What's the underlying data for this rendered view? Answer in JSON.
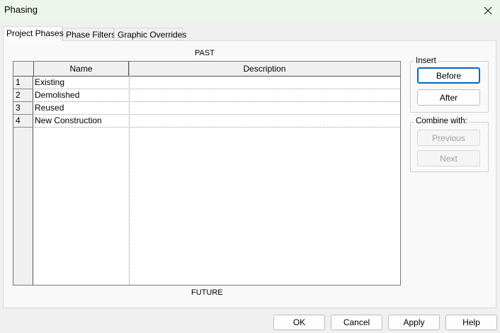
{
  "window": {
    "title": "Phasing"
  },
  "tabs": [
    {
      "label": "Project Phases",
      "active": true
    },
    {
      "label": "Phase Filters",
      "active": false
    },
    {
      "label": "Graphic Overrides",
      "active": false
    }
  ],
  "phases": {
    "past_caption": "PAST",
    "future_caption": "FUTURE",
    "columns": [
      "Name",
      "Description"
    ],
    "rows": [
      {
        "num": "1",
        "name": "Existing",
        "description": ""
      },
      {
        "num": "2",
        "name": "Demolished",
        "description": ""
      },
      {
        "num": "3",
        "name": "Reused",
        "description": ""
      },
      {
        "num": "4",
        "name": "New Construction",
        "description": ""
      }
    ]
  },
  "insert": {
    "legend": "Insert",
    "before_label": "Before",
    "after_label": "After"
  },
  "combine": {
    "legend": "Combine with:",
    "previous_label": "Previous",
    "next_label": "Next"
  },
  "footer": {
    "ok_label": "OK",
    "cancel_label": "Cancel",
    "apply_label": "Apply",
    "help_label": "Help"
  },
  "icons": {
    "close": "close-icon"
  },
  "colors": {
    "titlebar": "#eef5ea",
    "default_button_border": "#0067c0"
  }
}
